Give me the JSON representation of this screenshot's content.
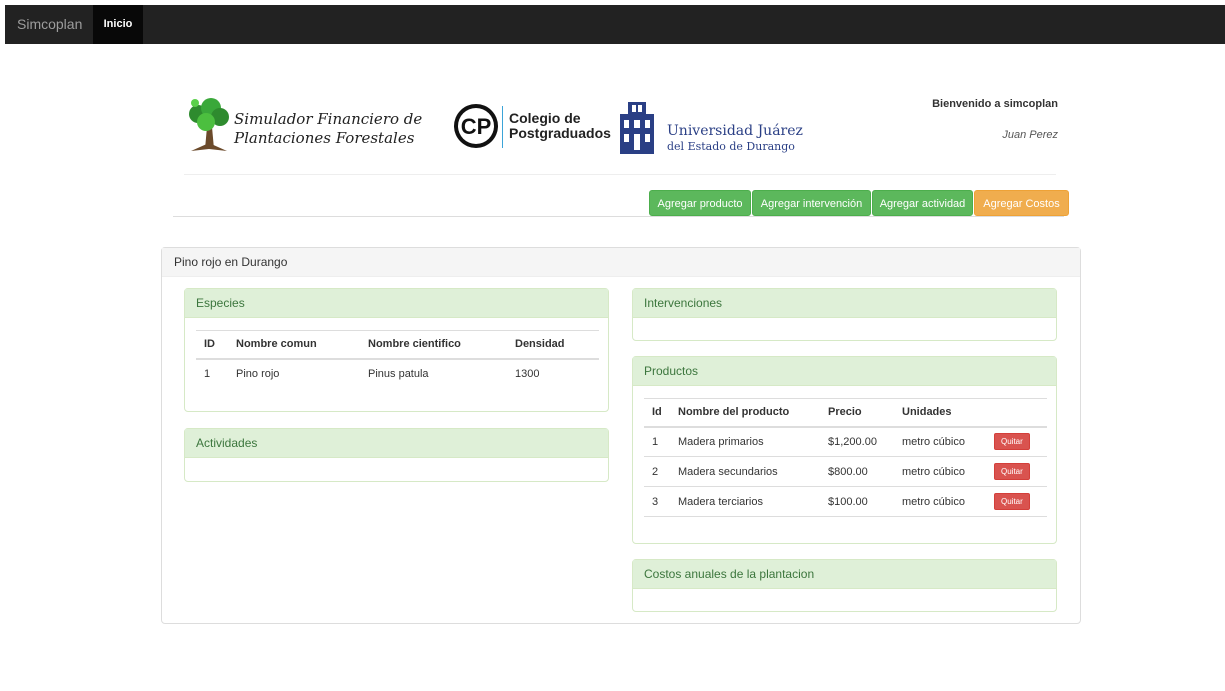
{
  "navbar": {
    "brand": "Simcoplan",
    "active_item": "Inicio"
  },
  "header": {
    "logo_sim": {
      "line1": "Simulador Financiero de",
      "line2": "Plantaciones Forestales"
    },
    "logo_cp": {
      "mark": "CP",
      "line1": "Colegio de",
      "line2": "Postgraduados"
    },
    "logo_ujed": {
      "name": "Universidad Juárez",
      "sub": "del Estado de Durango"
    },
    "welcome": "Bienvenido a simcoplan",
    "user": "Juan Perez"
  },
  "actions": {
    "add_product": "Agregar producto",
    "add_intervention": "Agregar intervención",
    "add_activity": "Agregar actividad",
    "add_costs": "Agregar Costos"
  },
  "plantation": {
    "title": "Pino rojo en Durango",
    "species": {
      "title": "Especies",
      "columns": [
        "ID",
        "Nombre comun",
        "Nombre cientifico",
        "Densidad"
      ],
      "rows": [
        [
          "1",
          "Pino rojo",
          "Pinus patula",
          "1300"
        ]
      ]
    },
    "activities": {
      "title": "Actividades"
    },
    "interventions": {
      "title": "Intervenciones"
    },
    "products": {
      "title": "Productos",
      "columns": [
        "Id",
        "Nombre del producto",
        "Precio",
        "Unidades"
      ],
      "remove_label": "Quitar",
      "rows": [
        [
          "1",
          "Madera primarios",
          "$1,200.00",
          "metro cúbico"
        ],
        [
          "2",
          "Madera secundarios",
          "$800.00",
          "metro cúbico"
        ],
        [
          "3",
          "Madera terciarios",
          "$100.00",
          "metro cúbico"
        ]
      ]
    },
    "annual_costs": {
      "title": "Costos anuales de la plantacion"
    }
  },
  "colors": {
    "navbar": "#222222",
    "success": "#5cb85c",
    "warning": "#f0ad4e",
    "danger": "#d9534f",
    "panel_heading": "#dff0d8"
  }
}
